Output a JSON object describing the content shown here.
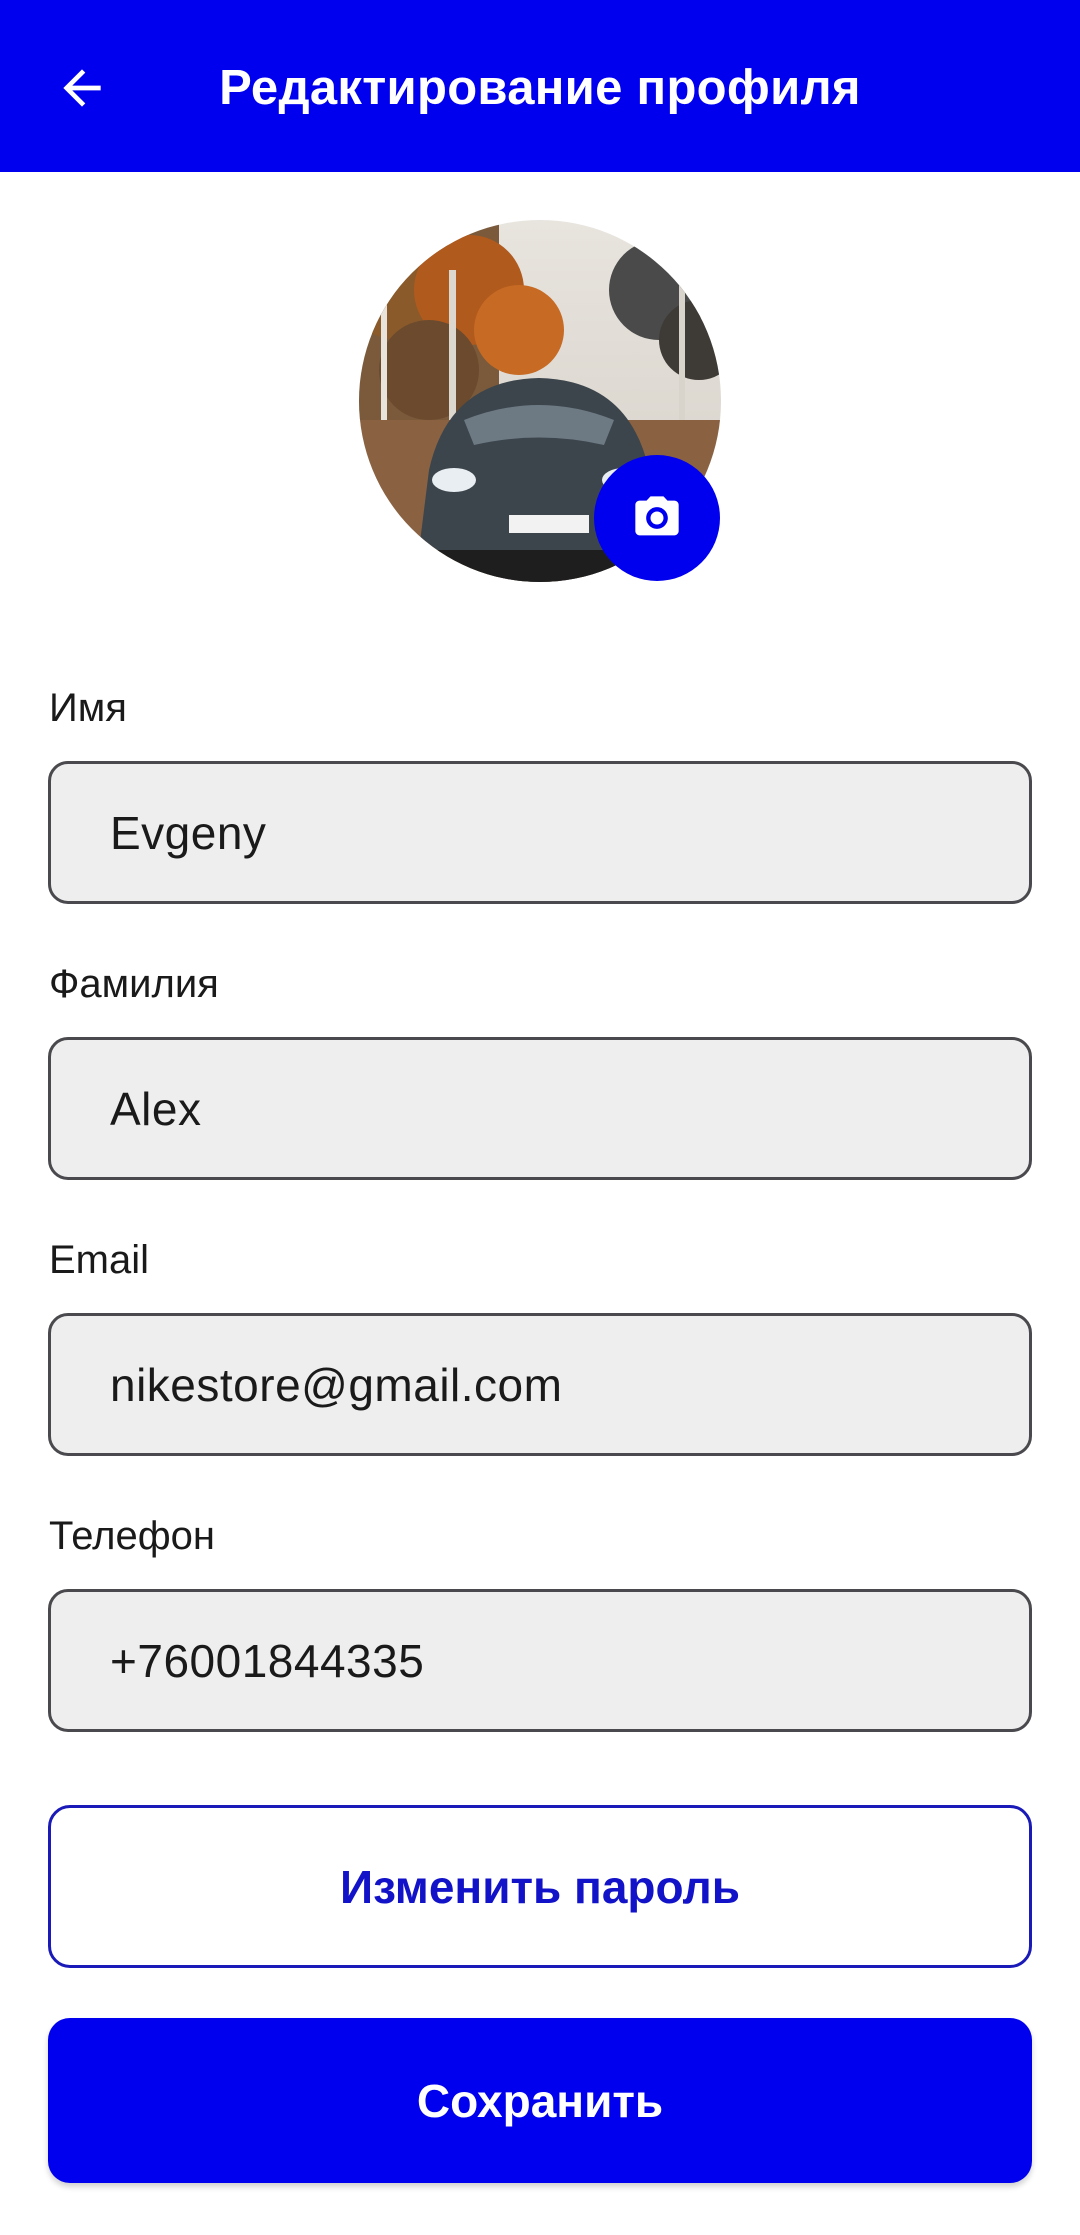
{
  "appbar": {
    "title": "Редактирование профиля",
    "back_icon": "arrow-left-icon"
  },
  "avatar": {
    "camera_icon": "camera-icon"
  },
  "form": {
    "first_name": {
      "label": "Имя",
      "value": "Evgeny"
    },
    "last_name": {
      "label": "Фамилия",
      "value": "Alex"
    },
    "email": {
      "label": "Email",
      "value": "nikestore@gmail.com"
    },
    "phone": {
      "label": "Телефон",
      "value": "+76001844335"
    }
  },
  "buttons": {
    "change_password": "Изменить пароль",
    "save": "Сохранить"
  },
  "colors": {
    "primary": "#0000ee",
    "field_bg": "#eeeeee",
    "field_border": "#4a4a4e"
  }
}
